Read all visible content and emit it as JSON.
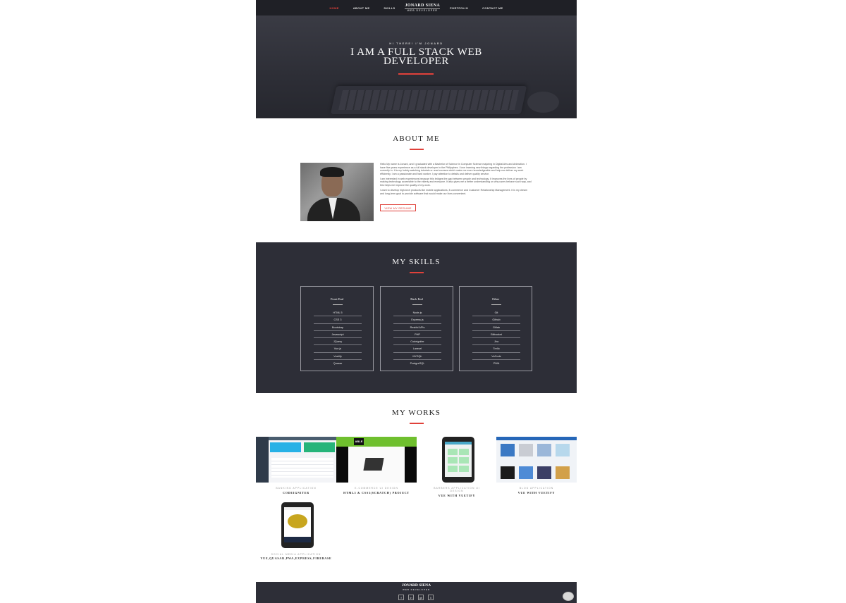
{
  "nav": {
    "left": [
      "HOME",
      "ABOUT ME",
      "SKILLS"
    ],
    "brand_name": "JONARD SIENA",
    "brand_sub": "WEB DEVELOPER",
    "right": [
      "PORTFOLIO",
      "CONTACT ME"
    ]
  },
  "hero": {
    "kicker": "HI THERE! I'M JONARD",
    "title_line1": "I AM A FULL STACK WEB",
    "title_line2": "DEVELOPER"
  },
  "about": {
    "title": "ABOUT ME",
    "p1": "Hello My name is Jonard, and I graduated with a Bachelor of Science in Computer Science majoring in Digital Arts and Animation. I have five years experience as a full stack developer in the Philippines. I love learning new things regarding the profession I am currently in. It is my hobby watching tutorials or read courses which make me more knowledgeable and help me deliver my work efficiently. I am a passionate and hard worker. I pay attention to details and deliver quality service.",
    "p2": "I am interested in web experiences because this bridges the gap between people and technology. It improves the lives of people by making technology accessible to the elderly and everyone. It also gives me a better understanding on why users behave such way, and this helps me improve the quality of my work.",
    "p3": "I want to develop high-tech products like mobile applications, E-commerce and Customer Relationship Management. It is my dream and long-term goal to provide software that would make our lives convenient.",
    "button": "VIEW MY RESUME"
  },
  "skills": {
    "title": "MY SKILLS",
    "cards": [
      {
        "title": "Front End",
        "items": [
          "HTML 5",
          "CSS 3",
          "Bootstrap",
          "Javascript",
          "JQuery",
          "Vue.js",
          "Vuetify",
          "Quasar"
        ]
      },
      {
        "title": "Back End",
        "items": [
          "Node.js",
          "Express.js",
          "Restful APIs",
          "PHP",
          "Codeigniter",
          "Laravel",
          "MYSQL",
          "PostgreSQL"
        ]
      },
      {
        "title": "Other",
        "items": [
          "Git",
          "Github",
          "Gitlab",
          "Bitbucket",
          "Jira",
          "Trello",
          "VsCode",
          "PWA"
        ]
      }
    ]
  },
  "works": {
    "title": "MY WORKS",
    "items": [
      {
        "category": "BANKING APPLICATION",
        "name": "CODEIGNITER"
      },
      {
        "category": "E-COMMERCE UI DESIGN",
        "name": "HTML5 & CSS3(SCRATCH) PROJECT"
      },
      {
        "category": "BARBERS APPLICATION UI DESIGN",
        "name": "VUE WITH VUETIFY"
      },
      {
        "category": "BLOG APPLICATION",
        "name": "VUE WITH VUETIFY"
      },
      {
        "category": "SOCIAL MEDIA APPLICATION",
        "name": "VUE,QUASAR,PWA,EXPRESS,FIREBASE"
      }
    ],
    "shop_logo": "ABLE"
  },
  "footer": {
    "brand_name": "JONARD SIENA",
    "brand_sub": "WEB DEVELOPER",
    "socials": [
      "f",
      "in",
      "gh",
      "li"
    ]
  },
  "icons": {
    "social": [
      "facebook-icon",
      "linkedin-icon",
      "github-icon",
      "gitlab-icon"
    ],
    "chat": "chat-bubble-icon"
  },
  "colors": {
    "accent": "#e0413a",
    "dark": "#2d2e37"
  }
}
